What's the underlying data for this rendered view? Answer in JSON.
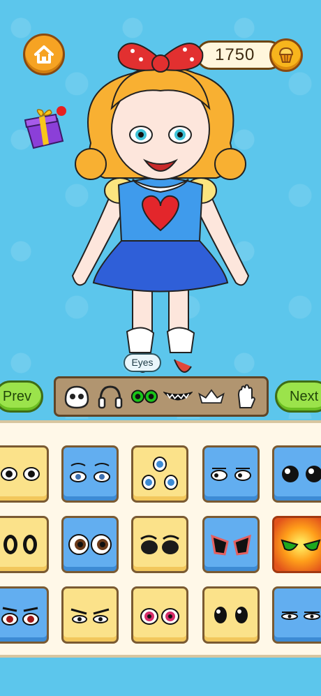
{
  "coins": "1750",
  "tooltip": "Eyes",
  "nav": {
    "prev": "Prev",
    "next": "Next"
  },
  "categories": [
    {
      "name": "face-icon"
    },
    {
      "name": "headphones-icon"
    },
    {
      "name": "eyes-icon",
      "selected": true
    },
    {
      "name": "mouth-icon"
    },
    {
      "name": "hat-icon"
    },
    {
      "name": "hand-icon"
    }
  ],
  "colors": {
    "sky": "#5cc6ec",
    "accent": "#f6a323",
    "nav_green": "#9be34b",
    "tile_yellow": "#fbe28a",
    "tile_blue": "#62aef0"
  },
  "grid": [
    [
      "round-eyes",
      "sleepy-eyes",
      "three-eyes",
      "sideways-eyes",
      "black-white-eyes"
    ],
    [
      "oval-black-eyes",
      "brown-eyes",
      "dark-goggle-eyes",
      "red-rim-eyes",
      "fire-green-eyes"
    ],
    [
      "red-eyes",
      "angry-eyes",
      "pink-eyes",
      "black-drop-eyes",
      "narrow-eyes"
    ]
  ]
}
